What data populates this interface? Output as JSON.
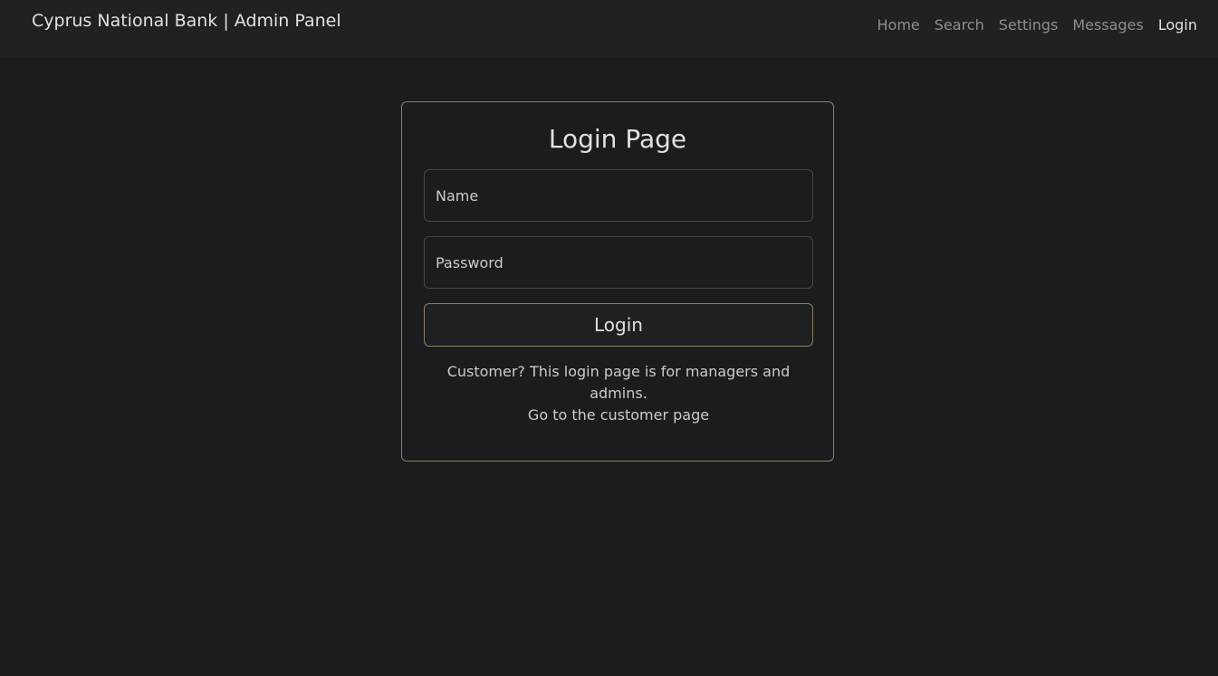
{
  "navbar": {
    "brand": "Cyprus National Bank | Admin Panel",
    "links": [
      {
        "label": "Home"
      },
      {
        "label": "Search"
      },
      {
        "label": "Settings"
      },
      {
        "label": "Messages"
      },
      {
        "label": "Login",
        "active": true
      }
    ]
  },
  "login": {
    "title": "Login Page",
    "name_placeholder": "Name",
    "password_placeholder": "Password",
    "button_label": "Login",
    "note_text": "Customer? This login page is for managers and admins.",
    "customer_link": "Go to the customer page"
  },
  "colors": {
    "background": "#1a1c1e",
    "navbar": "#1f2123",
    "card_border": "#8c8166",
    "text": "#dee2e6",
    "muted_link": "#8c9196"
  }
}
